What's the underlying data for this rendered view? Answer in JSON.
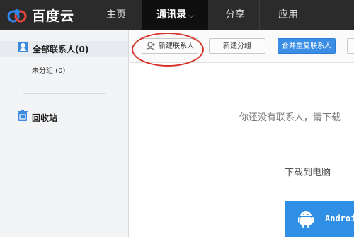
{
  "app": {
    "logo_text": "百度云",
    "brand_color": "#2b2b2b",
    "accent": "#3a8ee6"
  },
  "nav": {
    "home": "主页",
    "contacts": "通讯录",
    "share": "分享",
    "apps": "应用",
    "active": "contacts"
  },
  "sidebar": {
    "all_contacts": "全部联系人(0)",
    "ungrouped": "未分组 (0)",
    "recycle_bin": "回收站"
  },
  "toolbar": {
    "new_contact": "新建联系人",
    "new_group": "新建分组",
    "merge_duplicates": "合并重复联系人"
  },
  "main": {
    "empty_message": "你还没有联系人，请下载",
    "download_pc": "下载到电脑",
    "android_label": "Android"
  },
  "icons": [
    "cloud-logo-icon",
    "chevron-down-icon",
    "contacts-icon",
    "recycle-bin-icon",
    "add-user-icon",
    "android-icon"
  ]
}
